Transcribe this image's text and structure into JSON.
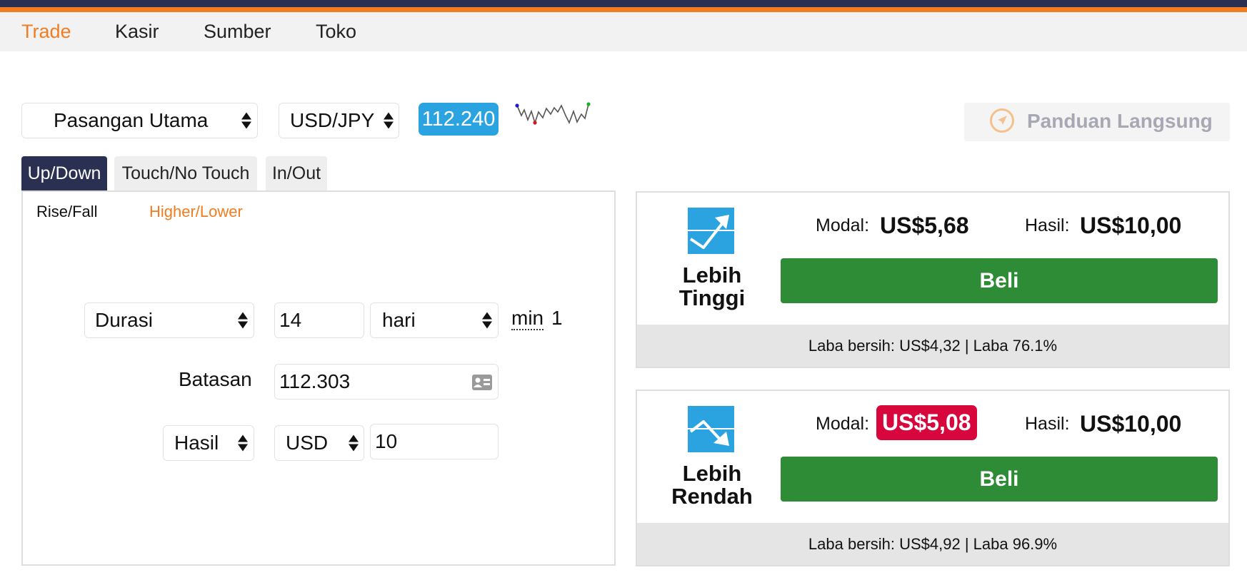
{
  "nav": {
    "items": [
      "Trade",
      "Kasir",
      "Sumber",
      "Toko"
    ],
    "active_color": "#f07d22"
  },
  "market": {
    "market_select": "Pasangan Utama",
    "symbol_select": "USD/JPY",
    "spot": "112.240",
    "spot_color": "#2aa3e0"
  },
  "guide": {
    "label": "Panduan Langsung",
    "icon": "compass-icon"
  },
  "tabs": [
    "Up/Down",
    "Touch/No Touch",
    "In/Out"
  ],
  "subtabs": [
    "Rise/Fall",
    "Higher/Lower"
  ],
  "form": {
    "duration_type": "Durasi",
    "duration_value": "14",
    "duration_unit": "hari",
    "duration_min": "min",
    "duration_min_value": "1",
    "barrier_label": "Batasan",
    "barrier_value": "112.303",
    "basis": "Hasil",
    "currency": "USD",
    "amount": "10"
  },
  "contracts": [
    {
      "name_line1": "Lebih",
      "name_line2": "Tinggi",
      "icon": "trend-up-icon",
      "stake_label": "Modal:",
      "stake": "US$5,68",
      "payout_label": "Hasil:",
      "payout": "US$10,00",
      "buy_label": "Beli",
      "profit": "Laba bersih: US$4,32 | Laba 76.1%"
    },
    {
      "name_line1": "Lebih",
      "name_line2": "Rendah",
      "icon": "trend-down-icon",
      "stake_label": "Modal:",
      "stake": "US$5,08",
      "payout_label": "Hasil:",
      "payout": "US$10,00",
      "buy_label": "Beli",
      "profit": "Laba bersih: US$4,92 | Laba 96.9%"
    }
  ],
  "colors": {
    "header_dark": "#2a3052",
    "brand_orange": "#f07d22",
    "buy_green": "#2e8b36",
    "stake_changed_red": "#d7063c"
  }
}
